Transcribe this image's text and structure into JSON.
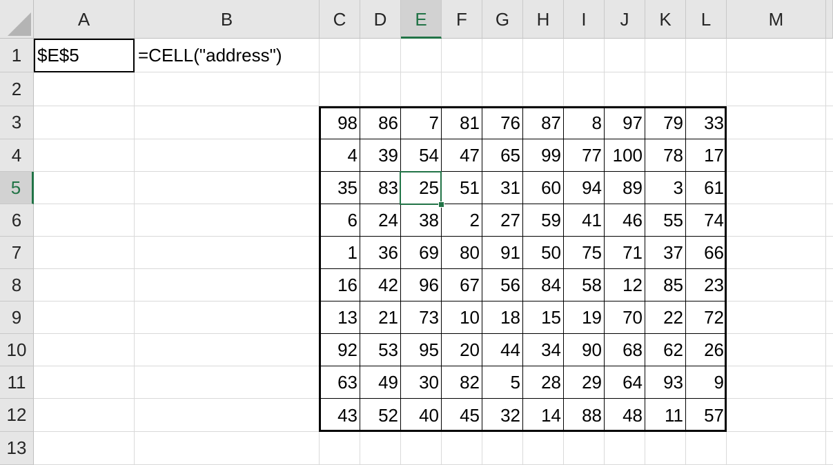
{
  "columns": [
    "A",
    "B",
    "C",
    "D",
    "E",
    "F",
    "G",
    "H",
    "I",
    "J",
    "K",
    "L",
    "M"
  ],
  "rows": [
    "1",
    "2",
    "3",
    "4",
    "5",
    "6",
    "7",
    "8",
    "9",
    "10",
    "11",
    "12",
    "13"
  ],
  "active_cell": {
    "column": "E",
    "row": "5"
  },
  "cells": {
    "A1": "$E$5",
    "B1": "=CELL(\"address\")"
  },
  "table": [
    [
      "98",
      "86",
      "7",
      "81",
      "76",
      "87",
      "8",
      "97",
      "79",
      "33"
    ],
    [
      "4",
      "39",
      "54",
      "47",
      "65",
      "99",
      "77",
      "100",
      "78",
      "17"
    ],
    [
      "35",
      "83",
      "25",
      "51",
      "31",
      "60",
      "94",
      "89",
      "3",
      "61"
    ],
    [
      "6",
      "24",
      "38",
      "2",
      "27",
      "59",
      "41",
      "46",
      "55",
      "74"
    ],
    [
      "1",
      "36",
      "69",
      "80",
      "91",
      "50",
      "75",
      "71",
      "37",
      "66"
    ],
    [
      "16",
      "42",
      "96",
      "67",
      "56",
      "84",
      "58",
      "12",
      "85",
      "23"
    ],
    [
      "13",
      "21",
      "73",
      "10",
      "18",
      "15",
      "19",
      "70",
      "22",
      "72"
    ],
    [
      "92",
      "53",
      "95",
      "20",
      "44",
      "34",
      "90",
      "68",
      "62",
      "26"
    ],
    [
      "63",
      "49",
      "30",
      "82",
      "5",
      "28",
      "29",
      "64",
      "93",
      "9"
    ],
    [
      "43",
      "52",
      "40",
      "45",
      "32",
      "14",
      "88",
      "48",
      "11",
      "57"
    ]
  ],
  "colors": {
    "accent": "#217346",
    "header_bg": "#e6e6e6",
    "gridline": "#d9d9d9",
    "table_border": "#000000"
  }
}
